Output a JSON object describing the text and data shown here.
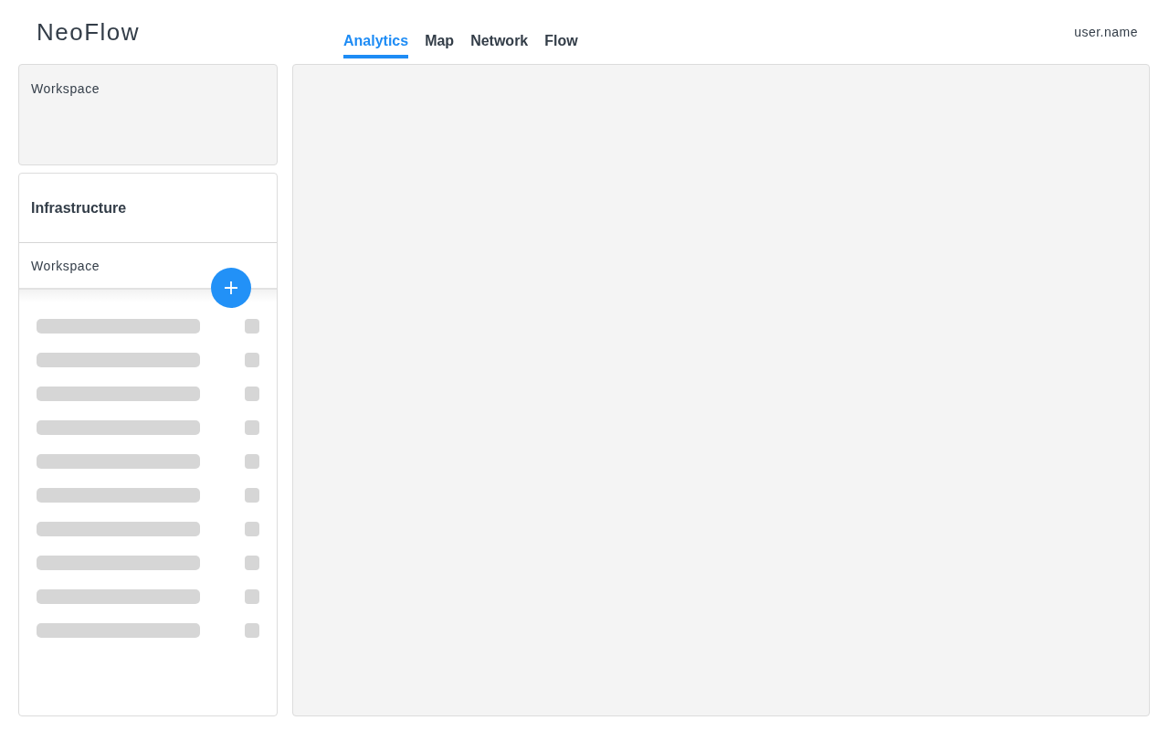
{
  "app": {
    "title": "NeoFlow"
  },
  "tabs": [
    {
      "label": "Analytics",
      "selected": true
    },
    {
      "label": "Map",
      "selected": false
    },
    {
      "label": "Network",
      "selected": false
    },
    {
      "label": "Flow",
      "selected": false
    }
  ],
  "user": {
    "name": "user.name"
  },
  "sidebar": {
    "workspace_card": {
      "label": "Workspace"
    },
    "section": {
      "title": "Infrastructure",
      "item": "Workspace"
    }
  }
}
